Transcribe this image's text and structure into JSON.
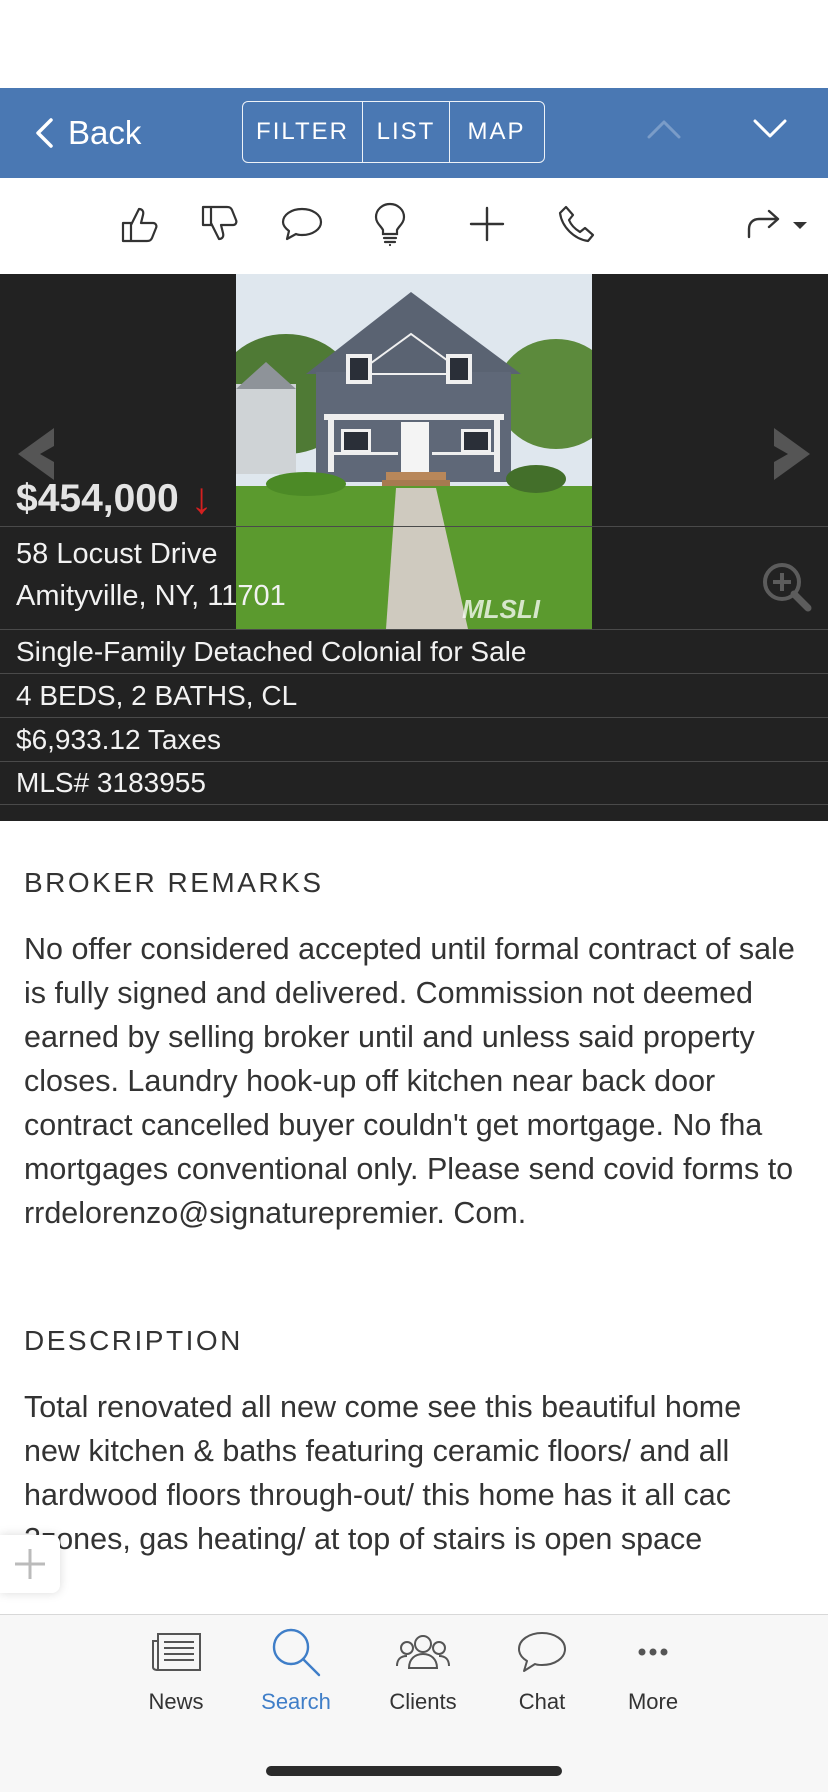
{
  "nav": {
    "back_label": "Back",
    "segments": [
      "FILTER",
      "LIST",
      "MAP"
    ]
  },
  "actions": [
    "thumbs-up-icon",
    "thumbs-down-icon",
    "comment-icon",
    "lightbulb-icon",
    "plus-icon",
    "phone-icon",
    "share-icon"
  ],
  "listing": {
    "price": "$454,000",
    "price_trend": "↓",
    "address_line1": "58 Locust Drive",
    "address_line2": "Amityville, NY, 11701",
    "photo_watermark": "MLSLI",
    "type": "Single-Family Detached Colonial for Sale",
    "beds_baths": "4 BEDS, 2 BATHS, CL",
    "taxes": "$6,933.12 Taxes",
    "mls": "MLS# 3183955"
  },
  "broker_remarks": {
    "title": "BROKER REMARKS",
    "body": "No offer considered accepted until formal contract of sale is fully signed and delivered. Commission not deemed earned by selling broker until and unless said property closes. Laundry hook-up off kitchen near back door contract cancelled buyer couldn't get mortgage. No fha mortgages conventional only. Please send covid forms to rrdelorenzo@signaturepremier. Com."
  },
  "description": {
    "title": "DESCRIPTION",
    "body": "Total renovated all new come see this beautiful home new kitchen & baths featuring ceramic floors/ and all hardwood floors through-out/ this home has it all cac 2zones, gas heating/ at top of stairs is open space"
  },
  "tabs": [
    {
      "label": "News",
      "icon": "newspaper-icon"
    },
    {
      "label": "Search",
      "icon": "search-icon",
      "active": true
    },
    {
      "label": "Clients",
      "icon": "clients-icon"
    },
    {
      "label": "Chat",
      "icon": "chat-icon"
    },
    {
      "label": "More",
      "icon": "more-icon"
    }
  ],
  "colors": {
    "nav_blue": "#4a78b3",
    "hero_dark": "#222222",
    "price_drop_red": "#d42020",
    "active_tab_blue": "#3f7ec8"
  }
}
